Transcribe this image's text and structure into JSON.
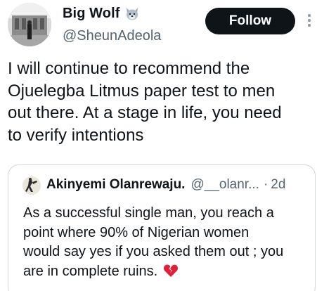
{
  "author": {
    "display_name": "Big Wolf",
    "handle": "@SheunAdeola",
    "badge_icon": "wolf-emoji-icon"
  },
  "actions": {
    "follow_label": "Follow",
    "more_icon": "more-vertical-icon"
  },
  "tweet": {
    "lines": [
      "I will continue to recommend the",
      "Ojuelegba Litmus paper test to men",
      "out there. At a stage in life, you need",
      "to verify intentions"
    ]
  },
  "quote": {
    "display_name": "Akinyemi Olanrewaju.",
    "handle": "@__olanr...",
    "separator": "·",
    "time": "2d",
    "lines": [
      "As a successful single man, you reach a",
      "point where 90% of Nigerian women",
      "would say yes if you asked them out ; you",
      "are in complete ruins."
    ],
    "trailing_icon": "broken-heart-emoji-icon"
  },
  "colors": {
    "text_primary": "#0f1419",
    "text_secondary": "#536471",
    "follow_bg": "#0f1419",
    "border": "#cfd9de",
    "broken_heart": "#e0203a"
  }
}
